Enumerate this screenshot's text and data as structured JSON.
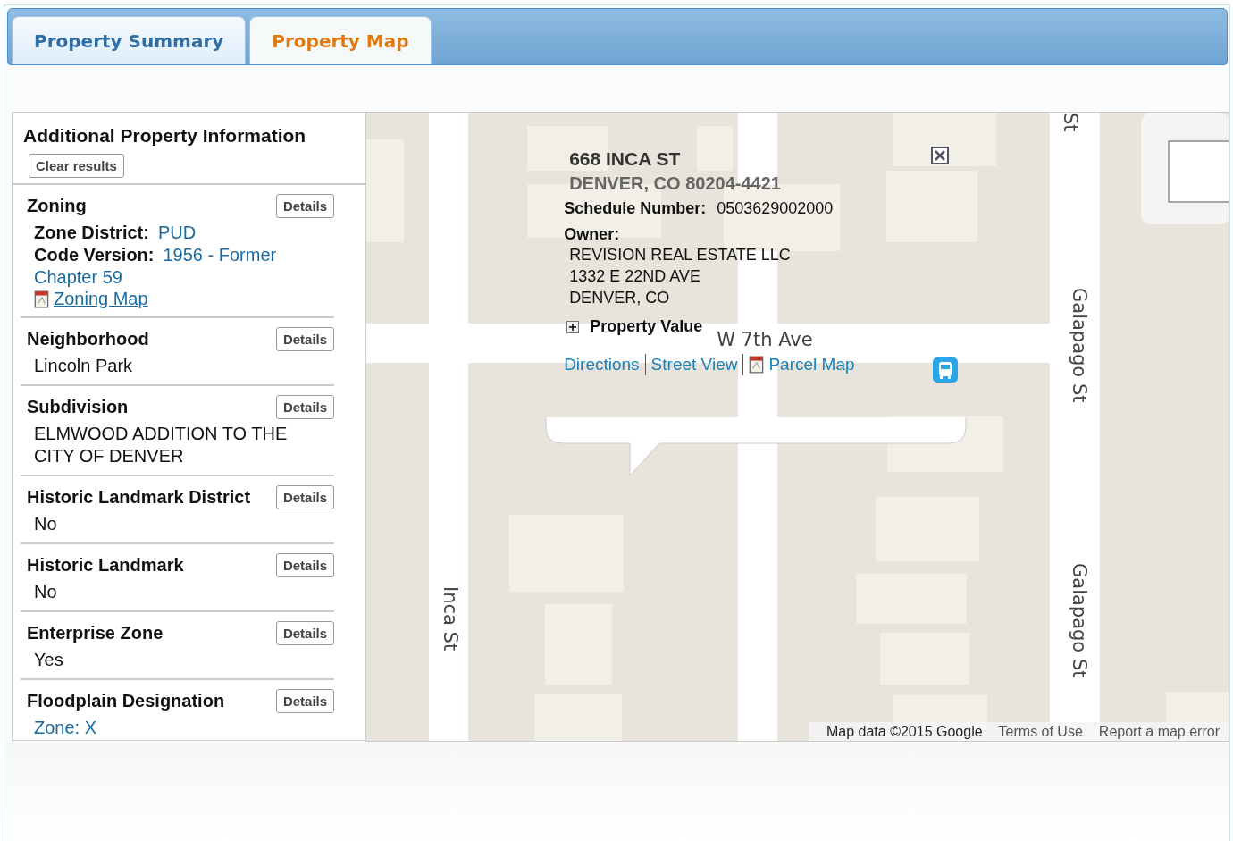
{
  "tabs": [
    {
      "label": "Property Summary",
      "selected": false
    },
    {
      "label": "Property Map",
      "selected": true
    }
  ],
  "panel": {
    "title": "Additional Property Information",
    "clear_button": "Clear results",
    "sections": [
      {
        "kind": "zoning",
        "title": "Zoning",
        "button": "Details",
        "fields": [
          {
            "label": "Zone District:",
            "value": "PUD"
          },
          {
            "label": "Code Version:",
            "value": "1956 - Former Chapter 59"
          }
        ],
        "link": "Zoning Map"
      },
      {
        "kind": "text",
        "title": "Neighborhood",
        "button": "Details",
        "value": "Lincoln Park"
      },
      {
        "kind": "text",
        "title": "Subdivision",
        "button": "Details",
        "value": "ELMWOOD ADDITION TO THE CITY OF DENVER"
      },
      {
        "kind": "text",
        "title": "Historic Landmark District",
        "button": "Details",
        "value": "No"
      },
      {
        "kind": "text",
        "title": "Historic Landmark",
        "button": "Details",
        "value": "No"
      },
      {
        "kind": "text",
        "title": "Enterprise Zone",
        "button": "Details",
        "value": "Yes"
      },
      {
        "kind": "link",
        "title": "Floodplain Designation",
        "button": "Details",
        "value": "Zone: X"
      }
    ]
  },
  "map": {
    "street_labels": [
      {
        "text": "St",
        "kind": "vertical"
      },
      {
        "text": "Galapago St",
        "kind": "vertical"
      },
      {
        "text": "W 7th Ave",
        "kind": "horizontal"
      },
      {
        "text": "Galapago St",
        "kind": "vertical"
      },
      {
        "text": "Inca St",
        "kind": "vertical"
      }
    ],
    "info": {
      "address": "668 INCA ST",
      "city": "DENVER, CO 80204-4421",
      "schedule_label": "Schedule Number:",
      "schedule_value": "0503629002000",
      "owner_label": "Owner:",
      "owner_lines": [
        "REVISION REAL ESTATE LLC",
        "1332 E 22ND AVE",
        "DENVER, CO"
      ],
      "property_value": "Property Value",
      "links": [
        {
          "label": "Directions",
          "kind": "plain"
        },
        {
          "label": "Street View",
          "kind": "plain"
        },
        {
          "label": "Parcel Map",
          "kind": "pdf"
        }
      ]
    },
    "footer": [
      {
        "text": "Map data ©2015 Google",
        "kind": "data"
      },
      {
        "text": "Terms of Use",
        "kind": "link"
      },
      {
        "text": "Report a map error",
        "kind": "link"
      }
    ]
  }
}
